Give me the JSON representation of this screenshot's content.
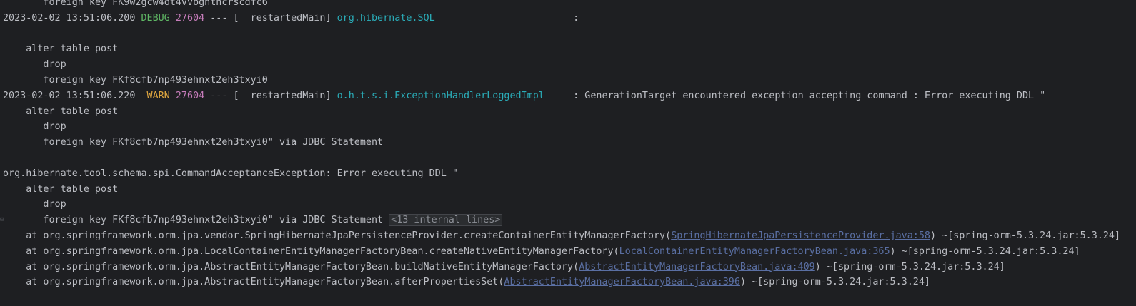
{
  "console": {
    "lines": [
      {
        "text": "       foreign key FK9w2gcw4ot4vvbghtncrscdfc6"
      },
      {
        "timestamp": "2023-02-02 13:51:06.200",
        "level": "DEBUG",
        "pid": "27604",
        "thread": " --- [  restartedMain] ",
        "logger": "org.hibernate.SQL",
        "message": "                        : "
      },
      {
        "text": ""
      },
      {
        "text": "    alter table post"
      },
      {
        "text": "       drop"
      },
      {
        "text": "       foreign key FKf8cfb7np493ehnxt2eh3txyi0"
      },
      {
        "timestamp": "2023-02-02 13:51:06.220",
        "level": " WARN",
        "pid": "27604",
        "thread": " --- [  restartedMain] ",
        "logger": "o.h.t.s.i.ExceptionHandlerLoggedImpl",
        "message": "     : GenerationTarget encountered exception accepting command : Error executing DDL \""
      },
      {
        "text": "    alter table post"
      },
      {
        "text": "       drop"
      },
      {
        "text": "       foreign key FKf8cfb7np493ehnxt2eh3txyi0\" via JDBC Statement"
      },
      {
        "text": ""
      },
      {
        "text": "org.hibernate.tool.schema.spi.CommandAcceptanceException: Error executing DDL \""
      },
      {
        "text": "    alter table post"
      },
      {
        "text": "       drop"
      },
      {
        "text": "       foreign key FKf8cfb7np493ehnxt2eh3txyi0\" via JDBC Statement ",
        "fold": "<13 internal lines>"
      },
      {
        "prefix": "    at org.springframework.orm.jpa.vendor.SpringHibernateJpaPersistenceProvider.createContainerEntityManagerFactory(",
        "link": "SpringHibernateJpaPersistenceProvider.java:58",
        "suffix": ") ~[spring-orm-5.3.24.jar:5.3.24]"
      },
      {
        "prefix": "    at org.springframework.orm.jpa.LocalContainerEntityManagerFactoryBean.createNativeEntityManagerFactory(",
        "link": "LocalContainerEntityManagerFactoryBean.java:365",
        "suffix": ") ~[spring-orm-5.3.24.jar:5.3.24]"
      },
      {
        "prefix": "    at org.springframework.orm.jpa.AbstractEntityManagerFactoryBean.buildNativeEntityManagerFactory(",
        "link": "AbstractEntityManagerFactoryBean.java:409",
        "suffix": ") ~[spring-orm-5.3.24.jar:5.3.24]"
      },
      {
        "prefix": "    at org.springframework.orm.jpa.AbstractEntityManagerFactoryBean.afterPropertiesSet(",
        "link": "AbstractEntityManagerFactoryBean.java:396",
        "suffix": ") ~[spring-orm-5.3.24.jar:5.3.24]"
      }
    ],
    "colors": {
      "background": "#1e1f22",
      "text": "#bcbec4",
      "debug": "#5fb865",
      "warn": "#e0a740",
      "pid": "#c77dbb",
      "logger": "#2aacb8",
      "link": "#5a6fa3"
    },
    "icons": {
      "fold_marker": "fold-gutter-icon"
    }
  }
}
